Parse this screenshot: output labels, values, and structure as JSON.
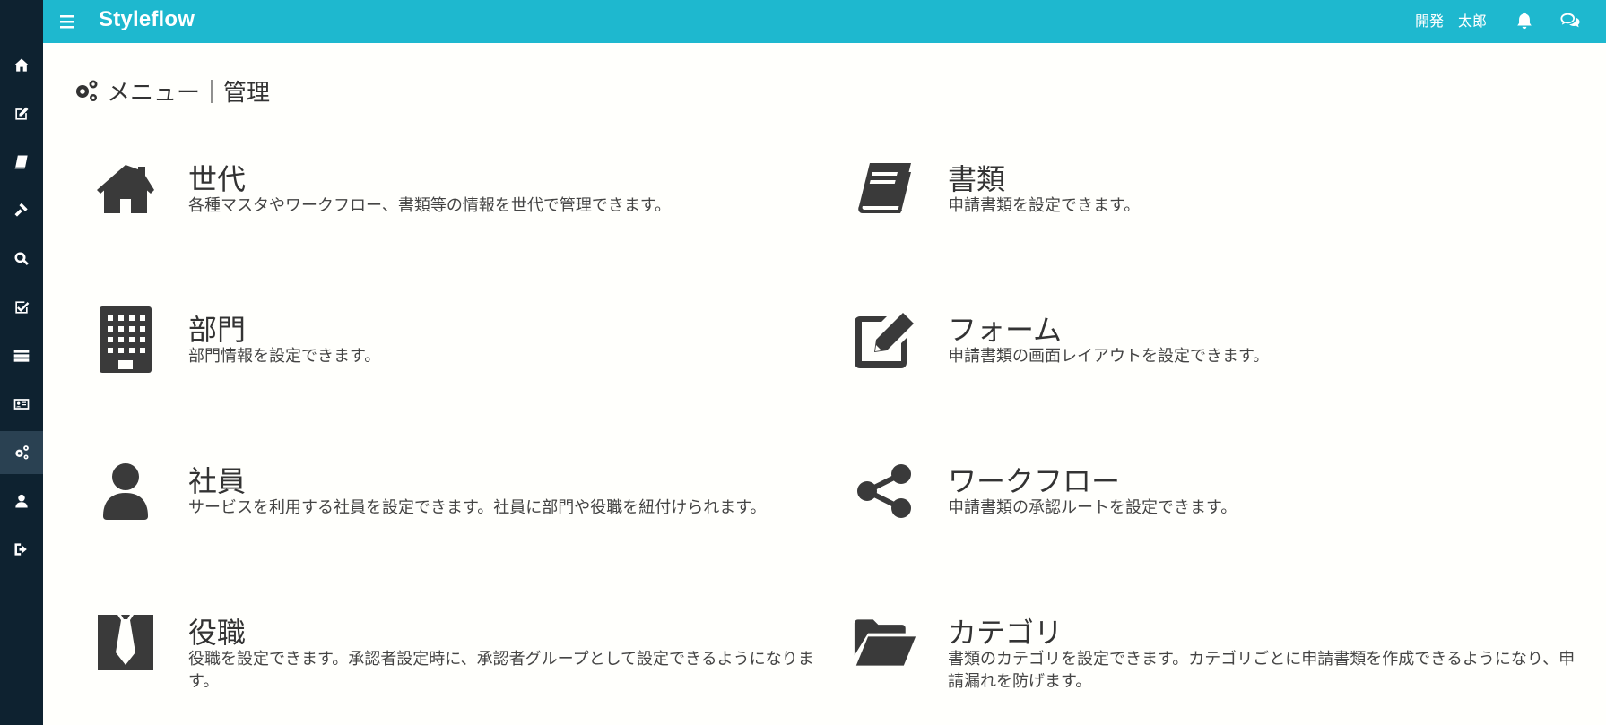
{
  "header": {
    "brand": "Styleflow",
    "user_name": "開発　太郎"
  },
  "sidebar": {
    "items": [
      {
        "icon": "home-icon"
      },
      {
        "icon": "edit-icon"
      },
      {
        "icon": "book-icon"
      },
      {
        "icon": "gavel-icon"
      },
      {
        "icon": "search-icon"
      },
      {
        "icon": "check-square-icon"
      },
      {
        "icon": "server-icon"
      },
      {
        "icon": "id-card-icon"
      },
      {
        "icon": "cogs-icon"
      },
      {
        "icon": "user-icon"
      },
      {
        "icon": "sign-out-icon"
      }
    ],
    "active_index": 8
  },
  "page": {
    "title": "メニュー｜管理"
  },
  "menu": [
    {
      "icon": "home-icon",
      "title": "世代",
      "desc": "各種マスタやワークフロー、書類等の情報を世代で管理できます。"
    },
    {
      "icon": "book-icon",
      "title": "書類",
      "desc": "申請書類を設定できます。"
    },
    {
      "icon": "building-icon",
      "title": "部門",
      "desc": "部門情報を設定できます。"
    },
    {
      "icon": "edit-icon",
      "title": "フォーム",
      "desc": "申請書類の画面レイアウトを設定できます。"
    },
    {
      "icon": "user-icon",
      "title": "社員",
      "desc": "サービスを利用する社員を設定できます。社員に部門や役職を紐付けられます。"
    },
    {
      "icon": "share-icon",
      "title": "ワークフロー",
      "desc": "申請書類の承認ルートを設定できます。"
    },
    {
      "icon": "tie-icon",
      "title": "役職",
      "desc": "役職を設定できます。承認者設定時に、承認者グループとして設定できるようになります。"
    },
    {
      "icon": "folder-open-icon",
      "title": "カテゴリ",
      "desc": "書類のカテゴリを設定できます。カテゴリごとに申請書類を作成できるようになり、申請漏れを防げます。"
    }
  ],
  "colors": {
    "header": "#1eb8cf",
    "sidebar": "#0e2230",
    "sidebar_active": "#2a4152",
    "icon": "#3a3a3a"
  }
}
